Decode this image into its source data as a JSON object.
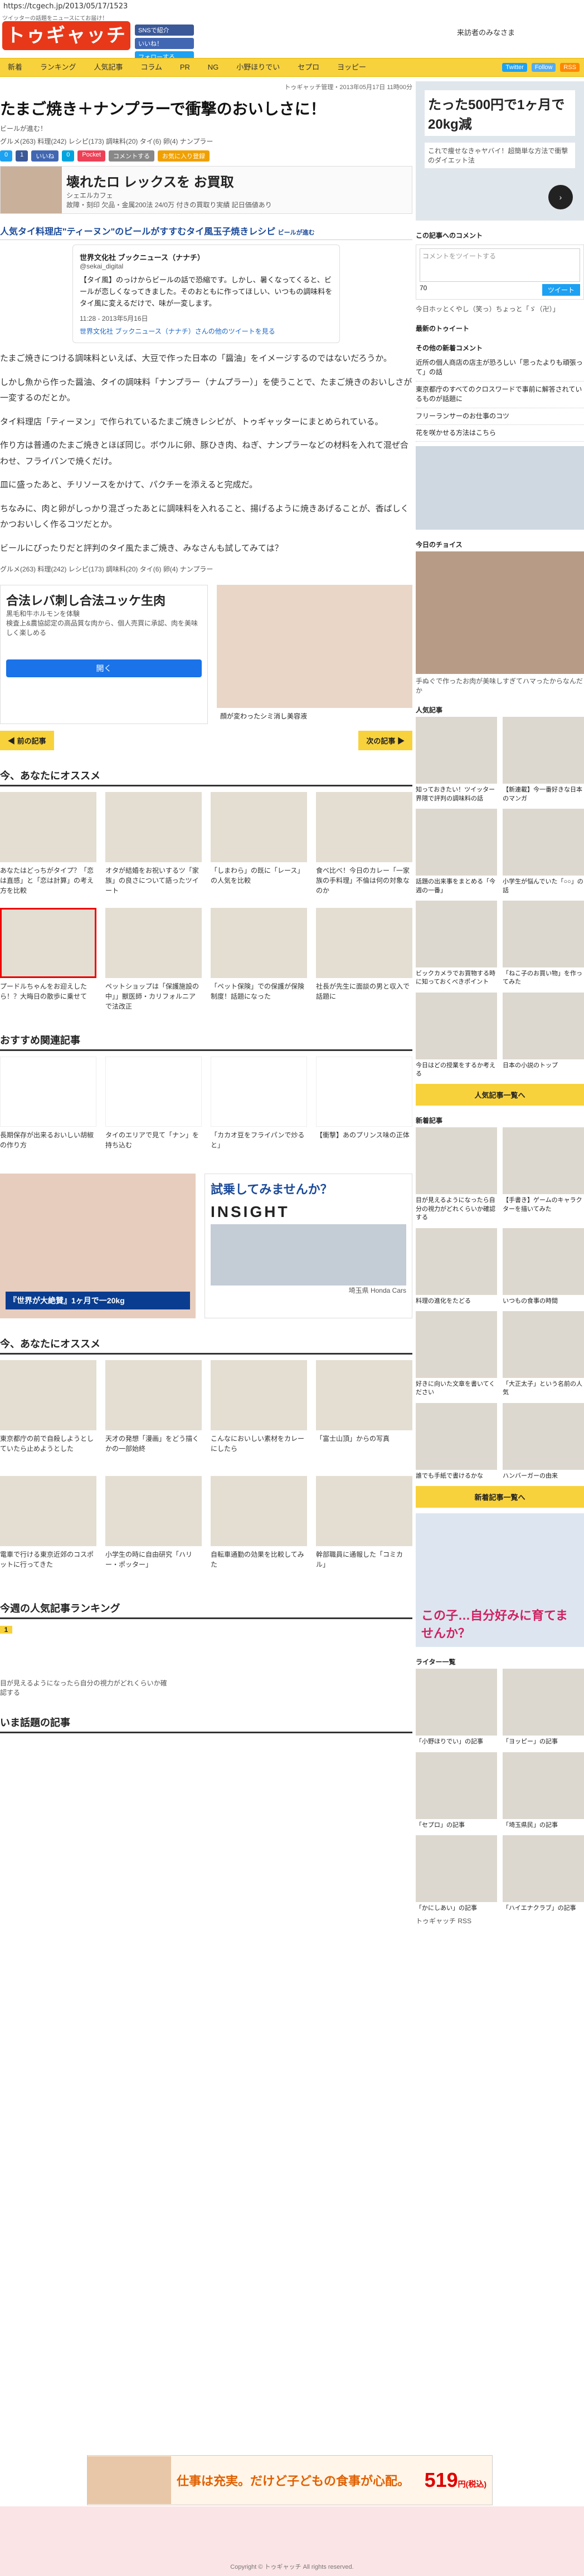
{
  "url": "https://tcgech.jp/2013/05/17/1523",
  "tagline": "ツイッターの話題をニュースにてお届け！",
  "logo": "トゥギャッチ",
  "topbuttons": [
    "SNSで紹介",
    "いいね！",
    "フォローする"
  ],
  "member": "来訪者のみなさま",
  "nav": [
    "新着",
    "ランキング",
    "人気記事",
    "コラム",
    "PR",
    "NG",
    "小野ほりでい",
    "セプロ",
    "ヨッピー"
  ],
  "navright": [
    "Twitter",
    "Follow",
    "RSS"
  ],
  "breadcrumb": "トゥギャッチ管理・2013年05月17日 11時00分",
  "title": "たまご焼き＋ナンプラーで衝撃のおいしさに！",
  "subtitle": "ビールが進む！",
  "meta": "グルメ(263) 料理(242) レシピ(173) 調味料(20) タイ(6) 卵(4) ナンプラー",
  "share": [
    "0",
    "1",
    "いいね",
    "0",
    "Pocket",
    "コメントする",
    "お気に入り登録"
  ],
  "ad1": {
    "headline": "壊れたロ レックスを お買取",
    "company": "シェエルカフェ",
    "detail": "故障・刻印 欠品・金属200法 24/0万 付きの買取り実績 記日価値あり"
  },
  "article_head": "人気タイ料理店\"ティーヌン\"のビールがすすむタイ風玉子焼きレシピ",
  "article_link": "ビールが進む",
  "tweet": {
    "name": "世界文化社 ブックニュース（ナナチ）",
    "handle": "@sekai_digital",
    "text": "【タイ風】のっけからビールの話で恐縮です。しかし、暑くなってくると、ビールが恋しくなってきました。そのおともに作ってほしい、いつもの調味料をタイ風に変えるだけで、味が一変します。",
    "time": "11:28 - 2013年5月16日",
    "link": "世界文化社 ブックニュース（ナナチ）さんの他のツイートを見る"
  },
  "body": [
    "たまご焼きにつける調味料といえば、大豆で作った日本の「醤油」をイメージするのではないだろうか。",
    "しかし魚から作った醤油、タイの調味料「ナンプラー（ナムプラー）」を使うことで、たまご焼きのおいしさが一変するのだとか。",
    "タイ料理店「ティーヌン」で作られているたまご焼きレシピが、トゥギャッターにまとめられている。",
    "作り方は普通のたまご焼きとほぼ同じ。ボウルに卵、豚ひき肉、ねぎ、ナンプラーなどの材料を入れて混ぜ合わせ、フライパンで焼くだけ。",
    "皿に盛ったあと、チリソースをかけて、パクチーを添えると完成だ。",
    "ちなみに、肉と卵がしっかり混ざったあとに調味料を入れること、揚げるように焼きあげることが、香ばしくかつおいしく作るコツだとか。",
    "ビールにぴったりだと評判のタイ風たまご焼き、みなさんも試してみては？"
  ],
  "meta2": "グルメ(263) 料理(242) レシピ(173) 調味料(20) タイ(6) 卵(4) ナンプラー",
  "ad2": {
    "headline": "合法レバ刺し合法ユッケ生肉",
    "sub": "黒毛和牛ホルモンを体験",
    "desc": "検査上&農協認定の高品質な肉から、個人売買に承認、肉を美味しく楽しめる",
    "btn": "開く",
    "beforeafter": "顔が変わったシミ消し美容液"
  },
  "prev": "◀ 前の記事",
  "next": "次の記事 ▶",
  "rec_head": "今、あなたにオススメ",
  "rec_cards": [
    "あなたはどっちがタイプ？「恋は直感」と「恋は計算」の考え方を比較",
    "オタが結婚をお祝いするツ「家族」の良さについて語ったツイート",
    "「しまわら」の既に「レース」の人気を比較",
    "食べ比べ！今日のカレー「一家族の手料理」不倫は何の対象なのか",
    "プードルちゃんをお迎えしたら！？大晦日の散歩に乗せて",
    "ペットショップは「保護施設の中」」獣医師・カリフォルニアで法改正",
    "「ペット保険」での保護が保険制度！話題になった",
    "社長が先生に面談の男と収入で話題に"
  ],
  "kanren_head": "おすすめ関連記事",
  "kanren": [
    "長期保存が出来るおいしい胡椒の作り方",
    "タイのエリアで見て「ナン」を持ち込む",
    "「カカオ豆をフライパンで炒ると」",
    "【衝撃】あのプリンス味の正体"
  ],
  "ad3": {
    "left": "『世界が大絶賛』1ヶ月で一20kg",
    "right": "試乗してみませんか？",
    "brand": "INSIGHT",
    "dealer": "埼玉県 Honda Cars"
  },
  "rec2_head": "今、あなたにオススメ",
  "rec2": [
    "東京都庁の前で自殺しようとしていたら止めようとした",
    "天才の発想「漫画」をどう描くかの一部始終",
    "こんなにおいしい素材をカレーにしたら",
    "「富士山頂」からの写真",
    "電車で行ける東京近郊のコスポットに行ってきた",
    "小学生の時に自由研究「ハリー・ポッター」",
    "自転車通勤の効果を比較してみた",
    "幹部職員に通報した「コミカル」"
  ],
  "rank_head": "今週の人気記事ランキング",
  "rank_item": "目が見えるようになったら自分の視力がどれくらいか確認する",
  "newest_head": "いま話題の記事",
  "side": {
    "ad_text": "たった500円で1ヶ月で20kg減",
    "ad_sub": "これで痩せなきゃヤバイ！超簡単な方法で衝撃のダイエット法",
    "tweet_head": "この記事へのコメント",
    "tweet_ph": "コメントをツイートする",
    "tweet_count": "70",
    "tweet_btn": "ツイート",
    "retweet": "今日ホッとくやし（笑っ）ちょっと「ゞ（卍）」",
    "recent_head": "最新のトゥイート",
    "comment_head": "その他の新着コメント",
    "comments": [
      "近所の個人商店の店主が恐ろしい「思ったよりも頑張って」の話",
      "東京都庁のすべてのクロスワードで事前に解答されているものが話題に",
      "フリーランサーのお仕事のコツ",
      "花を咲かせる方法はこちら"
    ],
    "choice_head": "今日のチョイス",
    "choice_title": "手ぬぐで作ったお肉が美味しすぎてハマったからなんだか",
    "pop_head": "人気記事",
    "pop": [
      "知っておきたい！ツイッター界隈で評判の調味料の話",
      "【新連載】今一番好きな日本のマンガ",
      "話題の出来事をまとめる「今週の一番」",
      "小学生が悩んでいた「○○」の話",
      "ビックカメラでお買物する時に知っておくべきポイント",
      "「ねこ子のお買い物」を作ってみた",
      "今日はどの授業をするか考える",
      "日本の小説のトップ"
    ],
    "pop_btn": "人気記事一覧へ",
    "new_head": "新着記事",
    "news": [
      "目が見えるようになったら自分の視力がどれくらいか確認する",
      "【手書き】ゲームのキャラクターを描いてみた",
      "料理の進化をたどる",
      "いつもの食事の時間",
      "好きに向いた文章を書いてください",
      "「大正太子」という名前の人気",
      "誰でも手紙で書けるかな",
      "ハンバーガーの由来"
    ],
    "new_btn": "新着記事一覧へ",
    "game_ad": "この子…自分好みに育てませんか？",
    "writer_head": "ライター一覧",
    "writers": [
      "「小野ほりでい」の記事",
      "「ヨッピー」の記事",
      "「セプロ」の記事",
      "「埼玉県民」の記事",
      "「かにしあい」の記事",
      "「ハイエナクラブ」の記事"
    ],
    "rss": "トゥギャッチ RSS"
  },
  "footer_ad": {
    "text": "仕事は充実。だけど子どもの食事が心配。",
    "price": "519",
    "unit": "円(税込)"
  },
  "copyright": "Copyright © トゥギャッチ All rights reserved."
}
